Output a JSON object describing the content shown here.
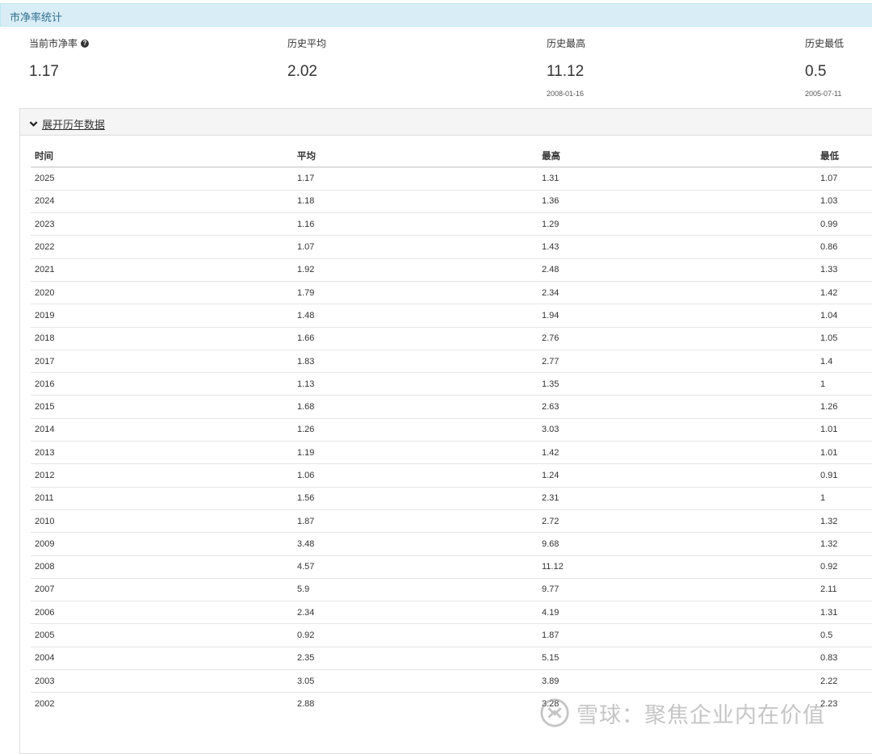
{
  "panel": {
    "title": "市净率统计"
  },
  "stats": [
    {
      "label": "当前市净率",
      "value": "1.17",
      "date": "",
      "help_icon": "question-circle-icon"
    },
    {
      "label": "历史平均",
      "value": "2.02",
      "date": ""
    },
    {
      "label": "历史最高",
      "value": "11.12",
      "date": "2008-01-16"
    },
    {
      "label": "历史最低",
      "value": "0.5",
      "date": "2005-07-11"
    }
  ],
  "history": {
    "toggle_label": "展开历年数据",
    "toggle_icon": "chevron-down-icon",
    "headers": [
      "时间",
      "平均",
      "最高",
      "最低"
    ],
    "rows": [
      [
        "2025",
        "1.17",
        "1.31",
        "1.07"
      ],
      [
        "2024",
        "1.18",
        "1.36",
        "1.03"
      ],
      [
        "2023",
        "1.16",
        "1.29",
        "0.99"
      ],
      [
        "2022",
        "1.07",
        "1.43",
        "0.86"
      ],
      [
        "2021",
        "1.92",
        "2.48",
        "1.33"
      ],
      [
        "2020",
        "1.79",
        "2.34",
        "1.42"
      ],
      [
        "2019",
        "1.48",
        "1.94",
        "1.04"
      ],
      [
        "2018",
        "1.66",
        "2.76",
        "1.05"
      ],
      [
        "2017",
        "1.83",
        "2.77",
        "1.4"
      ],
      [
        "2016",
        "1.13",
        "1.35",
        "1"
      ],
      [
        "2015",
        "1.68",
        "2.63",
        "1.26"
      ],
      [
        "2014",
        "1.26",
        "3.03",
        "1.01"
      ],
      [
        "2013",
        "1.19",
        "1.42",
        "1.01"
      ],
      [
        "2012",
        "1.06",
        "1.24",
        "0.91"
      ],
      [
        "2011",
        "1.56",
        "2.31",
        "1"
      ],
      [
        "2010",
        "1.87",
        "2.72",
        "1.32"
      ],
      [
        "2009",
        "3.48",
        "9.68",
        "1.32"
      ],
      [
        "2008",
        "4.57",
        "11.12",
        "0.92"
      ],
      [
        "2007",
        "5.9",
        "9.77",
        "2.11"
      ],
      [
        "2006",
        "2.34",
        "4.19",
        "1.31"
      ],
      [
        "2005",
        "0.92",
        "1.87",
        "0.5"
      ],
      [
        "2004",
        "2.35",
        "5.15",
        "0.83"
      ],
      [
        "2003",
        "3.05",
        "3.89",
        "2.22"
      ],
      [
        "2002",
        "2.88",
        "3.28",
        "2.23"
      ]
    ]
  },
  "watermark": {
    "text": "雪球：聚焦企业内在价值"
  },
  "colors": {
    "heading_bg": "#d9edf7",
    "heading_text": "#31708f",
    "header_bg": "#f5f5f5"
  }
}
